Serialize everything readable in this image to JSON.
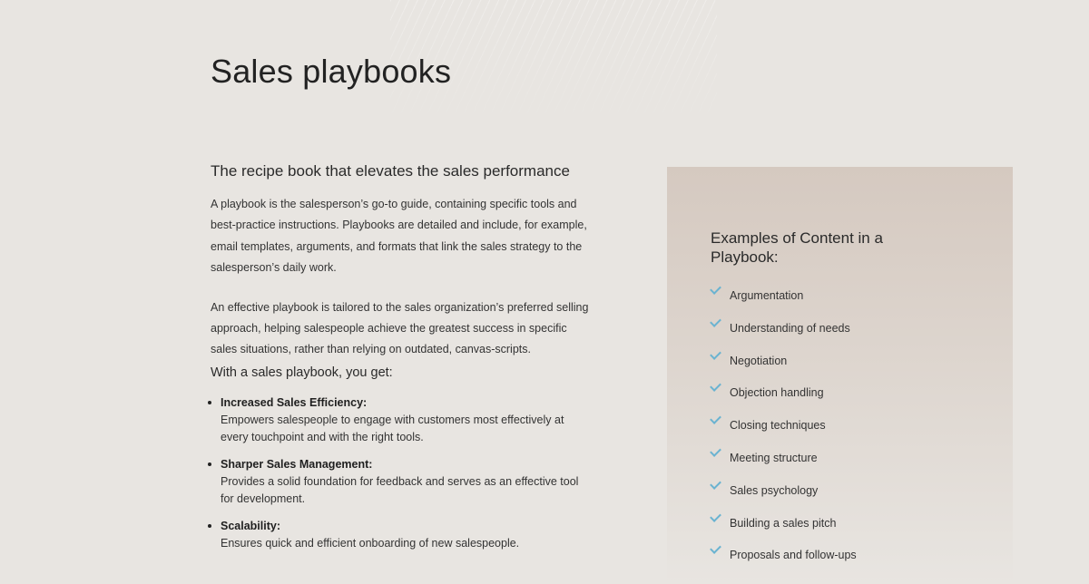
{
  "page": {
    "title": "Sales playbooks"
  },
  "intro": {
    "heading": "The recipe book that elevates the sales performance",
    "paragraphs": [
      "A playbook is the salesperson’s go-to guide, containing specific tools and best-practice instructions. Playbooks are detailed and include, for example, email templates, arguments, and formats that link the sales strategy to the salesperson’s daily work.",
      "An effective playbook is tailored to the sales organization’s preferred selling approach, helping salespeople achieve the greatest success in specific sales situations, rather than relying on outdated, canvas-scripts."
    ],
    "benefits_heading": "With a sales playbook, you get:",
    "benefits": [
      {
        "title": "Increased Sales Efficiency:",
        "description": "Empowers salespeople to engage with customers most effectively at every touchpoint and with the right tools."
      },
      {
        "title": "Sharper Sales Management:",
        "description": "Provides a solid foundation for feedback and serves as an effective tool for development."
      },
      {
        "title": "Scalability:",
        "description": "Ensures quick and efficient onboarding of new salespeople."
      }
    ]
  },
  "examples": {
    "title": "Examples of Content in a Playbook:",
    "icon": "check-icon",
    "accent_color": "#6ab3d1",
    "items": [
      "Argumentation",
      "Understanding of needs",
      "Negotiation",
      "Objection handling",
      "Closing techniques",
      "Meeting structure",
      "Sales psychology",
      "Building a sales pitch",
      "Proposals and follow-ups"
    ]
  }
}
